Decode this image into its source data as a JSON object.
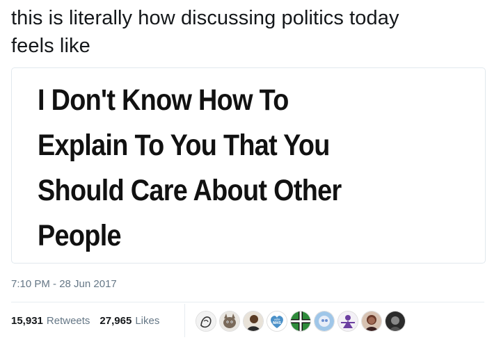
{
  "tweet": {
    "text_line1": "this is literally how discussing politics today",
    "text_line2": "feels like"
  },
  "card": {
    "headline_lines": [
      "I Don't Know How To",
      "Explain To You That You",
      "Should Care About Other",
      "People"
    ]
  },
  "meta": {
    "timestamp": "7:10 PM - 28 Jun 2017"
  },
  "stats": {
    "retweets_count": "15,931",
    "retweets_label": "Retweets",
    "likes_count": "27,965",
    "likes_label": "Likes"
  },
  "avatars": [
    {
      "name": "avatar-sketch"
    },
    {
      "name": "avatar-cat"
    },
    {
      "name": "avatar-person"
    },
    {
      "name": "avatar-vote-nhs",
      "text": "vote NHS",
      "color": "#4a90c8"
    },
    {
      "name": "avatar-flag",
      "color": "#2e8b3a"
    },
    {
      "name": "avatar-anime"
    },
    {
      "name": "avatar-purple-figure",
      "color": "#6b3fa0"
    },
    {
      "name": "avatar-woman"
    },
    {
      "name": "avatar-dark"
    }
  ]
}
